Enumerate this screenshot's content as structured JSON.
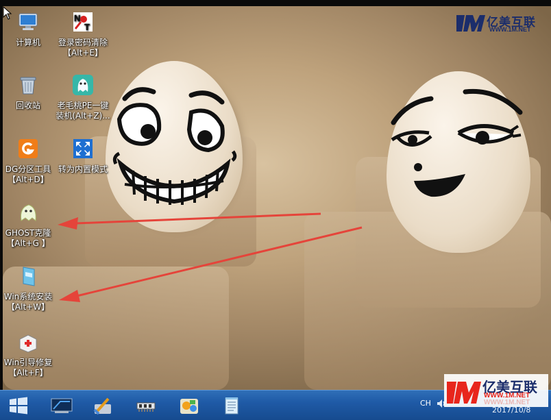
{
  "desktop": {
    "icons": [
      {
        "label1": "计算机",
        "label2": ""
      },
      {
        "label1": "登录密码清除",
        "label2": "【Alt+E】"
      },
      {
        "label1": "回收站",
        "label2": ""
      },
      {
        "label1": "老毛桃PE一键",
        "label2": "装机(Alt+Z)..."
      },
      {
        "label1": "DG分区工具",
        "label2": "【Alt+D】"
      },
      {
        "label1": "转为内置模式",
        "label2": ""
      },
      {
        "label1": "GHOST克隆",
        "label2": "【Alt+G 】"
      },
      {
        "label1": "Win系统安装",
        "label2": "【Alt+W】"
      },
      {
        "label1": "Win引导修复",
        "label2": "【Alt+F】"
      }
    ]
  },
  "watermark": {
    "top_brand": "亿美互联",
    "top_url": "WWW.1M.NET",
    "bottom_brand": "亿美互联",
    "bottom_url": "WWW.1M.NET",
    "bottom_url_ghost": "WWW.1M.NET",
    "accent": "#e8261c"
  },
  "taskbar": {
    "ime": "CH",
    "date": "2017/10/8"
  }
}
